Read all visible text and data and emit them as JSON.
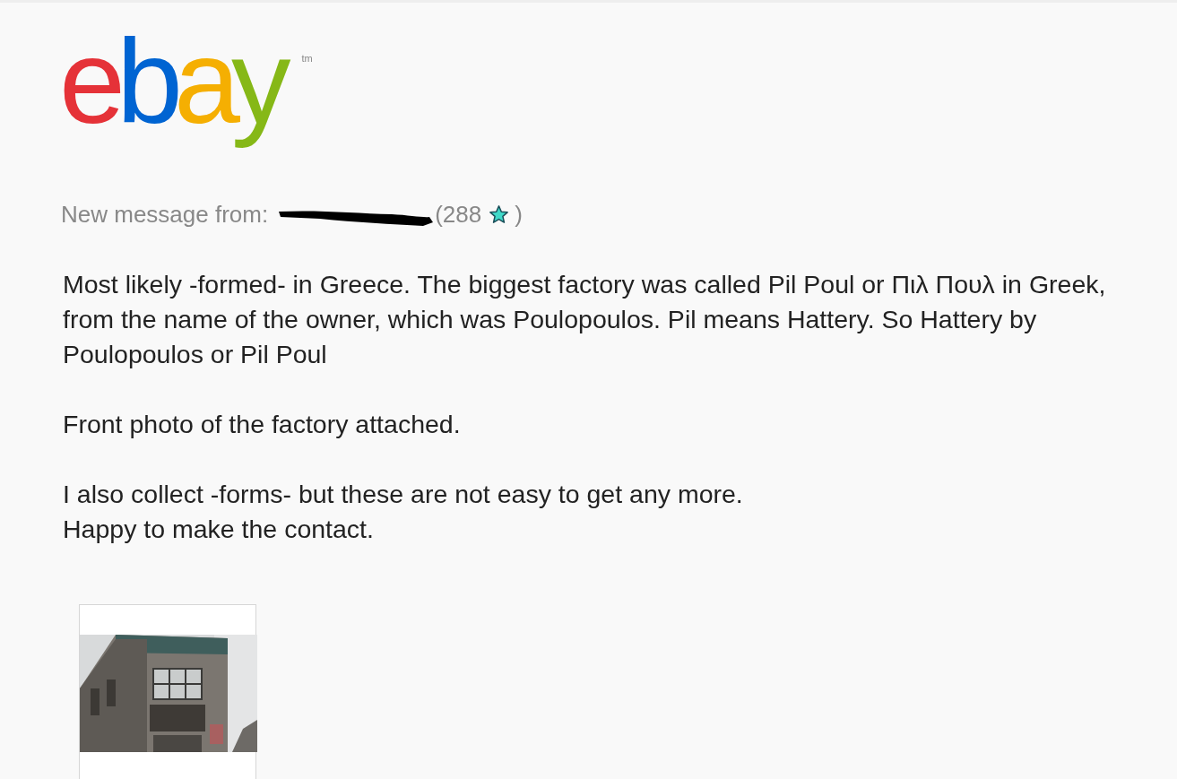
{
  "logo": {
    "letters": [
      {
        "text": "e",
        "color": "#e53238"
      },
      {
        "text": "b",
        "color": "#0064d2"
      },
      {
        "text": "a",
        "color": "#f5af02"
      },
      {
        "text": "y",
        "color": "#86b817"
      }
    ],
    "trademark": "tm"
  },
  "sender": {
    "label": "New message from:",
    "redacted": true,
    "score_open": "(288",
    "score_close": ")"
  },
  "paragraphs": [
    [
      "Most likely -formed- in Greece. The biggest factory was called Pil Poul or Πιλ Πουλ in Greek, from the name of the owner, which was Poulopoulos. Pil means Hattery. So Hattery by Poulopoulos or Pil Poul"
    ],
    [
      "Front photo of the factory attached."
    ],
    [
      "I also collect -forms- but these are not easy to get any more.",
      "Happy to make the contact."
    ]
  ],
  "attachments": [
    {
      "kind": "picture"
    }
  ]
}
